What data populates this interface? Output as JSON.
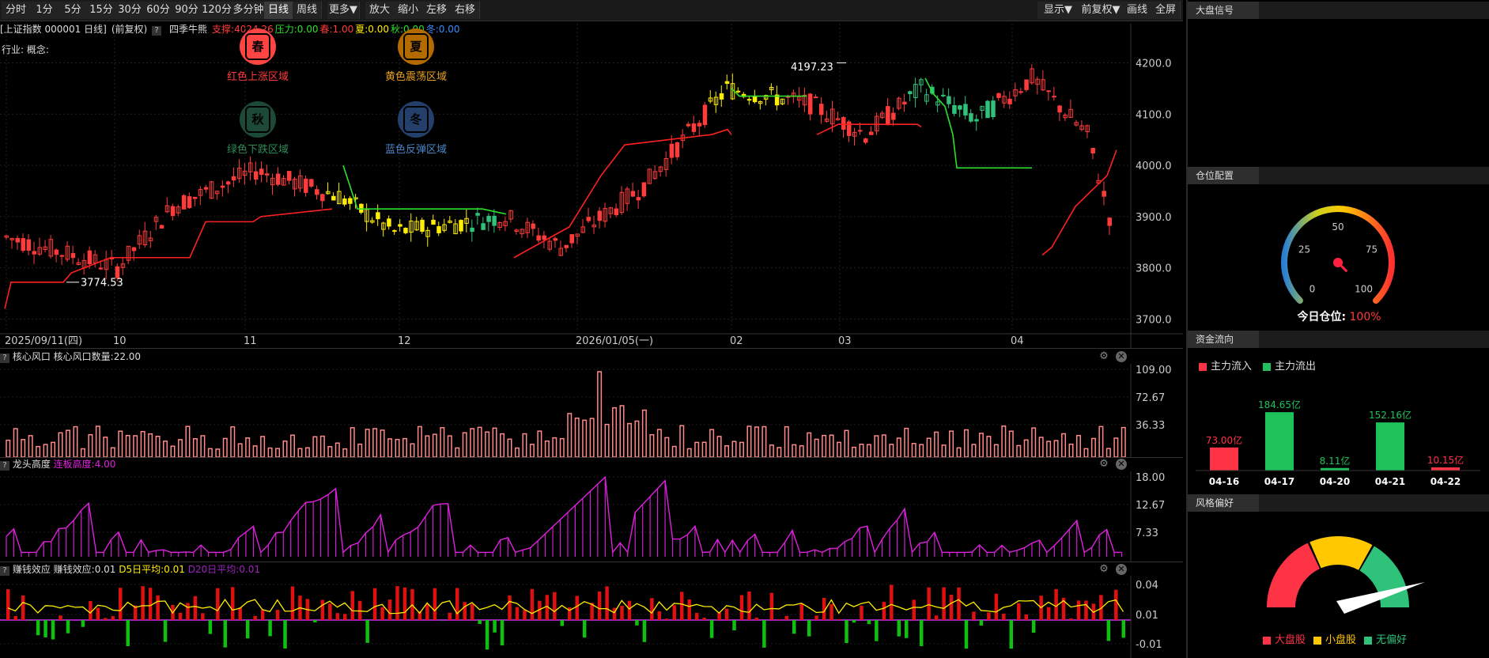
{
  "toolbar": {
    "left": [
      "分时",
      "1分",
      "5分",
      "15分",
      "30分",
      "60分",
      "90分",
      "120分",
      "多分钟",
      "日线",
      "周线",
      "更多▼",
      "放大",
      "缩小",
      "左移",
      "右移"
    ],
    "active": "日线",
    "right": [
      "显示▼",
      "前复权▼",
      "画线",
      "全屏"
    ]
  },
  "info": {
    "index": "[上证指数 000001 日线]",
    "fq": "(前复权)",
    "q": "?",
    "indicator": "四季牛熊",
    "support": "支撑:4024.26",
    "pressure": "压力:0.00",
    "spring": "春:1.00",
    "summer": "夏:0.00",
    "autumn": "秋:0.00",
    "winter": "冬:0.00",
    "industry": "行业: 概念:"
  },
  "main_chart": {
    "y_ticks": [
      "4200.0",
      "4100.0",
      "4000.0",
      "3900.0",
      "3800.0",
      "3700.0"
    ],
    "y_values": [
      4200,
      4100,
      4000,
      3900,
      3800,
      3700
    ],
    "high_label": "4197.23",
    "low_label": "3774.53",
    "x_labels": [
      "2025/09/11(四)",
      "10",
      "11",
      "12",
      "2026/01/05(一)",
      "02",
      "03",
      "04"
    ]
  },
  "sub1": {
    "q": "?",
    "title": "核心风口",
    "value": "核心风口数量:22.00",
    "ticks": [
      "109.00",
      "72.67",
      "36.33"
    ]
  },
  "sub2": {
    "q": "?",
    "title": "龙头高度",
    "value": "连板高度:4.00",
    "ticks": [
      "18.00",
      "12.67",
      "7.33"
    ]
  },
  "sub3": {
    "q": "?",
    "title": "赚钱效应",
    "value": "赚钱效应:0.01",
    "d5": "D5日平均:0.01",
    "d20": "D20日平均:0.01",
    "ticks": [
      "0.04",
      "0.01",
      "-0.01"
    ]
  },
  "icons": {
    "gear": "⚙",
    "close": "✕"
  },
  "right": {
    "signal_title": "大盘信号",
    "signals": [
      {
        "char": "春",
        "label": "红色上涨区域",
        "color": "#ff3b3b",
        "bg": "#ff4444",
        "text": "#ff3b3b"
      },
      {
        "char": "夏",
        "label": "黄色震荡区域",
        "color": "#f0a020",
        "bg": "#b36b00",
        "text": "#e6a020"
      },
      {
        "char": "秋",
        "label": "绿色下跌区域",
        "color": "#2a6b4a",
        "bg": "#1d4a36",
        "text": "#2e8b57"
      },
      {
        "char": "冬",
        "label": "蓝色反弹区域",
        "color": "#3a5d8c",
        "bg": "#24406a",
        "text": "#4a86c8"
      }
    ],
    "position_title": "仓位配置",
    "gauge_ticks": [
      "0",
      "25",
      "50",
      "75",
      "100"
    ],
    "today_label": "今日仓位:",
    "today_value": "100%",
    "gauge_value": 100,
    "flow_title": "资金流向",
    "flow_in": "主力流入",
    "flow_out": "主力流出",
    "style_title": "风格偏好",
    "style_legend": [
      "大盘股",
      "小盘股",
      "无偏好"
    ]
  },
  "chart_data": {
    "type": "bar",
    "title": "资金流向",
    "categories": [
      "04-16",
      "04-17",
      "04-20",
      "04-21",
      "04-22"
    ],
    "values": [
      73.0,
      184.65,
      8.11,
      152.16,
      10.15
    ],
    "value_labels": [
      "73.00亿",
      "184.65亿",
      "8.11亿",
      "152.16亿",
      "10.15亿"
    ],
    "direction": [
      "in",
      "out",
      "out",
      "out",
      "in"
    ],
    "colors": {
      "in": "#ff3346",
      "out": "#1ec25a"
    }
  }
}
